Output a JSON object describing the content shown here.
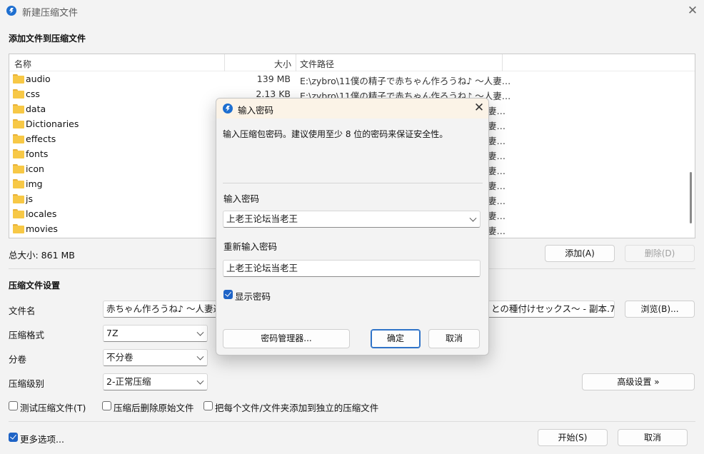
{
  "window": {
    "title": "新建压缩文件",
    "icon": "bolt-icon",
    "close_glyph": "✕"
  },
  "add_section": {
    "title": "添加文件到压缩文件"
  },
  "file_list": {
    "columns": [
      "名称",
      "大小",
      "文件路径"
    ],
    "rows": [
      {
        "name": "audio",
        "size": "139 MB",
        "path": "E:\\zybro\\11僕の精子で赤ちゃん作ろうね♪ ～人妻…"
      },
      {
        "name": "css",
        "size": "2.13 KB",
        "path": "E:\\zybro\\11僕の精子で赤ちゃん作ろうね♪ ～人妻…"
      },
      {
        "name": "data",
        "size": "",
        "path": "…"
      },
      {
        "name": "Dictionaries",
        "size": "",
        "path": "…"
      },
      {
        "name": "effects",
        "size": "",
        "path": "…"
      },
      {
        "name": "fonts",
        "size": "",
        "path": "…"
      },
      {
        "name": "icon",
        "size": "",
        "path": "…"
      },
      {
        "name": "img",
        "size": "",
        "path": "…"
      },
      {
        "name": "js",
        "size": "",
        "path": "…"
      },
      {
        "name": "locales",
        "size": "",
        "path": "…"
      },
      {
        "name": "movies",
        "size": "",
        "path": "…"
      }
    ],
    "path_tail": "妻…"
  },
  "total_size": "总大小: 861 MB",
  "buttons": {
    "add": "添加(A)",
    "delete": "删除(D)",
    "browse": "浏览(B)...",
    "advanced": "高级设置 »",
    "start": "开始(S)",
    "cancel": "取消"
  },
  "settings": {
    "title": "压缩文件设置",
    "filename_label": "文件名",
    "filename_value": "赤ちゃん作ろうね♪ ～人妻達と",
    "filename_value_tail": "との種付けセックス～ - 副本.7z",
    "format_label": "压缩格式",
    "format_value": "7Z",
    "volume_label": "分卷",
    "volume_value": "不分卷",
    "level_label": "压缩级别",
    "level_value": "2-正常压缩"
  },
  "options": {
    "test": "测试压缩文件(T)",
    "delete_after": "压缩后删除原始文件",
    "separate": "把每个文件/文件夹添加到独立的压缩文件",
    "more": "更多选项..."
  },
  "dialog": {
    "title": "输入密码",
    "message": "输入压缩包密码。建议使用至少 8 位的密码来保证安全性。",
    "password_label": "输入密码",
    "password_value": "上老王论坛当老王",
    "confirm_label": "重新输入密码",
    "confirm_value": "上老王论坛当老王",
    "show_password": "显示密码",
    "manager_button": "密码管理器...",
    "ok_button": "确定",
    "cancel_button": "取消"
  },
  "colors": {
    "accent": "#1e63c6",
    "folder": "#f7c846",
    "dialog_title_bg": "#fbf3e7"
  }
}
